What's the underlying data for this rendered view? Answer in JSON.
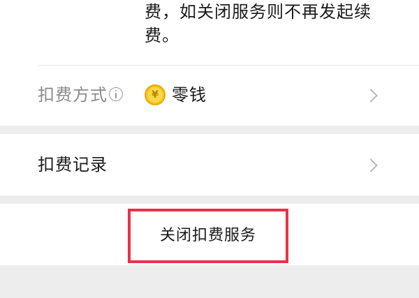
{
  "description": {
    "line1": "费，如关闭服务则不再发起续",
    "line2": "费。"
  },
  "payment_method": {
    "label": "扣费方式",
    "info_icon": "info-icon",
    "coin_symbol": "¥",
    "value": "零钱"
  },
  "deduction_record": {
    "label": "扣费记录"
  },
  "close_service": {
    "label": "关闭扣费服务",
    "highlight_color": "#e8324a"
  },
  "colors": {
    "background": "#ededed",
    "card": "#ffffff",
    "coin": "#f3c21f"
  }
}
